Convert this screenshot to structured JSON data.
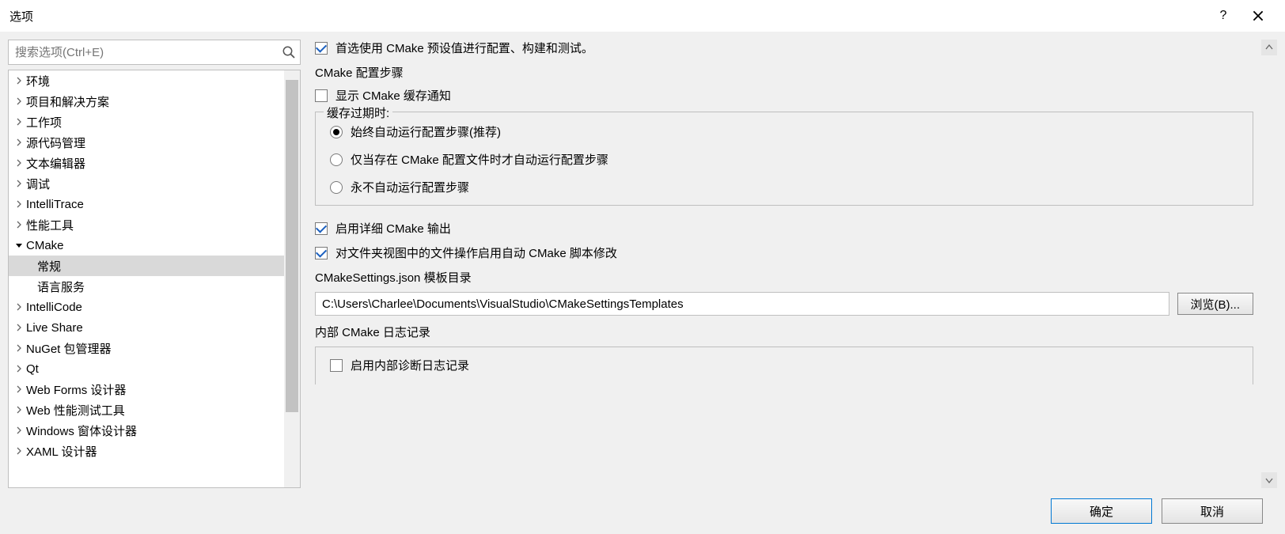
{
  "window": {
    "title": "选项"
  },
  "search": {
    "placeholder": "搜索选项(Ctrl+E)"
  },
  "tree": {
    "items": [
      {
        "label": "环境",
        "expanded": false,
        "level": 0
      },
      {
        "label": "项目和解决方案",
        "expanded": false,
        "level": 0
      },
      {
        "label": "工作项",
        "expanded": false,
        "level": 0
      },
      {
        "label": "源代码管理",
        "expanded": false,
        "level": 0
      },
      {
        "label": "文本编辑器",
        "expanded": false,
        "level": 0
      },
      {
        "label": "调试",
        "expanded": false,
        "level": 0
      },
      {
        "label": "IntelliTrace",
        "expanded": false,
        "level": 0
      },
      {
        "label": "性能工具",
        "expanded": false,
        "level": 0
      },
      {
        "label": "CMake",
        "expanded": true,
        "level": 0
      },
      {
        "label": "常规",
        "level": 1,
        "selected": true
      },
      {
        "label": "语言服务",
        "level": 1
      },
      {
        "label": "IntelliCode",
        "expanded": false,
        "level": 0
      },
      {
        "label": "Live Share",
        "expanded": false,
        "level": 0
      },
      {
        "label": "NuGet 包管理器",
        "expanded": false,
        "level": 0
      },
      {
        "label": "Qt",
        "expanded": false,
        "level": 0
      },
      {
        "label": "Web Forms 设计器",
        "expanded": false,
        "level": 0
      },
      {
        "label": "Web 性能测试工具",
        "expanded": false,
        "level": 0
      },
      {
        "label": "Windows 窗体设计器",
        "expanded": false,
        "level": 0
      },
      {
        "label": "XAML 设计器",
        "expanded": false,
        "level": 0
      }
    ]
  },
  "options": {
    "prefer_presets": {
      "label": "首选使用 CMake 预设值进行配置、构建和测试。",
      "checked": true
    },
    "config_steps_heading": "CMake 配置步骤",
    "show_cache_notify": {
      "label": "显示 CMake 缓存通知",
      "checked": false
    },
    "cache_expired_legend": "缓存过期时:",
    "cache_radio": [
      {
        "label": "始终自动运行配置步骤(推荐)",
        "checked": true
      },
      {
        "label": "仅当存在 CMake 配置文件时才自动运行配置步骤",
        "checked": false
      },
      {
        "label": "永不自动运行配置步骤",
        "checked": false
      }
    ],
    "verbose_output": {
      "label": "启用详细 CMake 输出",
      "checked": true
    },
    "auto_script_edit": {
      "label": "对文件夹视图中的文件操作启用自动 CMake 脚本修改",
      "checked": true
    },
    "templates_heading": "CMakeSettings.json 模板目录",
    "templates_path": "C:\\Users\\Charlee\\Documents\\VisualStudio\\CMakeSettingsTemplates",
    "browse_label": "浏览(B)...",
    "internal_log_heading": "内部 CMake 日志记录",
    "enable_diag_log": {
      "label": "启用内部诊断日志记录",
      "checked": false
    }
  },
  "footer": {
    "ok": "确定",
    "cancel": "取消"
  }
}
